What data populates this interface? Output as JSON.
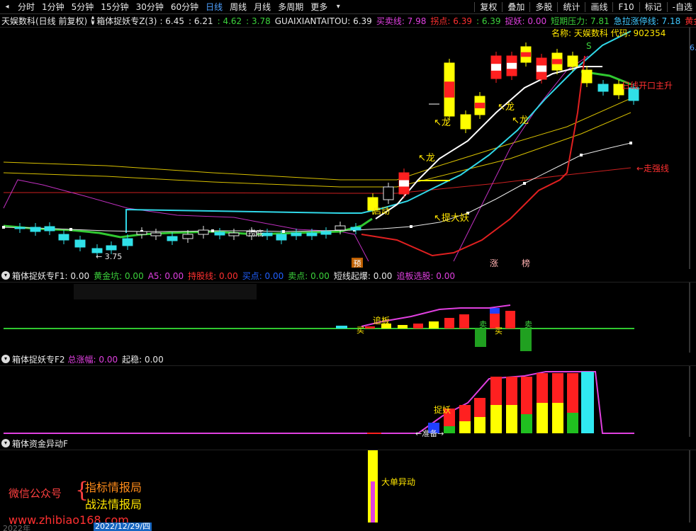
{
  "toolbar": {
    "left_items": [
      "分时",
      "1分钟",
      "5分钟",
      "15分钟",
      "30分钟",
      "60分钟",
      "日线",
      "周线",
      "月线",
      "多周期",
      "更多"
    ],
    "active": "日线",
    "right_items": [
      "复权",
      "叠加",
      "多股",
      "统计",
      "画线",
      "F10",
      "标记",
      "-自选"
    ]
  },
  "main": {
    "stock_label": "天娱数科(日线 前复权)",
    "indicator": "箱体捉妖专Z(3)",
    "values": [
      {
        "k": "",
        "v": ": 6.45",
        "color": "#e8e8e8"
      },
      {
        "k": "",
        "v": ": 6.21",
        "color": "#e8e8e8"
      },
      {
        "k": "",
        "v": ": 4.62",
        "color": "#3cd23c"
      },
      {
        "k": "",
        "v": ": 3.78",
        "color": "#3cd23c"
      },
      {
        "k": "GUAIXIANTAITOU",
        "v": ": 6.39",
        "color": "#e8e8e8"
      },
      {
        "k": "买卖线",
        "v": ": 7.98",
        "color": "#e040e0"
      },
      {
        "k": "拐点",
        "v": ": 6.39",
        "color": "#ff3030"
      },
      {
        "k": "",
        "v": ": 6.39",
        "color": "#3cd23c"
      },
      {
        "k": "捉妖",
        "v": ": 0.00",
        "color": "#e040e0"
      },
      {
        "k": "短期压力",
        "v": ": 7.81",
        "color": "#3cd23c"
      },
      {
        "k": "急拉涨停线",
        "v": ": 7.18",
        "color": "#40c8ff"
      },
      {
        "k": "黄金轨",
        "v": "◇",
        "color": "#ff3030"
      }
    ],
    "stock_tag": "名称: 天娱数科  代码: 902354",
    "tag_s": "S",
    "label_breakout": "日线开口主升",
    "label_strong": "←走强线",
    "label_dragon": "龙",
    "label_lift": "提大妖",
    "label_start": "启动",
    "label_low": "← 3.75",
    "label_yu": "预",
    "label_zhang": "涨",
    "label_bang": "榜",
    "label_bottom": "捞底",
    "right_axis_value": "6."
  },
  "f1": {
    "title": "箱体捉妖专F1",
    "values": [
      {
        "k": "",
        "v": ": 0.00",
        "color": "#e8e8e8"
      },
      {
        "k": "黄金坑",
        "v": ": 0.00",
        "color": "#3cd23c"
      },
      {
        "k": "A5",
        "v": ": 0.00",
        "color": "#e040e0"
      },
      {
        "k": "持股线",
        "v": ": 0.00",
        "color": "#ff3030"
      },
      {
        "k": "买点",
        "v": ": 0.00",
        "color": "#2060ff"
      },
      {
        "k": "卖点",
        "v": ": 0.00",
        "color": "#3cd23c"
      },
      {
        "k": "短线起爆",
        "v": ": 0.00",
        "color": "#e8e8e8"
      },
      {
        "k": "追板选股",
        "v": ": 0.00",
        "color": "#e040e0"
      }
    ],
    "label_chase": "追板",
    "label_buy": "买",
    "label_sell": "卖"
  },
  "f2": {
    "title": "箱体捉妖专F2",
    "values": [
      {
        "k": "总涨幅",
        "v": ": 0.00",
        "color": "#e040e0"
      },
      {
        "k": "起稳",
        "v": ": 0.00",
        "color": "#e8e8e8"
      }
    ],
    "label_catch": "捉妖",
    "label_prepare": "准备"
  },
  "f3": {
    "title": "箱体资金异动F",
    "label_big_order": "大单异动",
    "cursor_label": "2"
  },
  "watermark": {
    "left": "微信公众号",
    "right1": "指标情报局",
    "right2": "战法情报局",
    "url": "www.zhibiao168.com"
  },
  "dates": {
    "left": "2022年",
    "cursor": "2022/12/29/四"
  },
  "colors": {
    "up": "#ff2020",
    "down_cyan": "#30e0e8",
    "yellow": "#ffff00",
    "green": "#3cd23c",
    "magenta": "#e040e0",
    "white": "#ffffff"
  }
}
